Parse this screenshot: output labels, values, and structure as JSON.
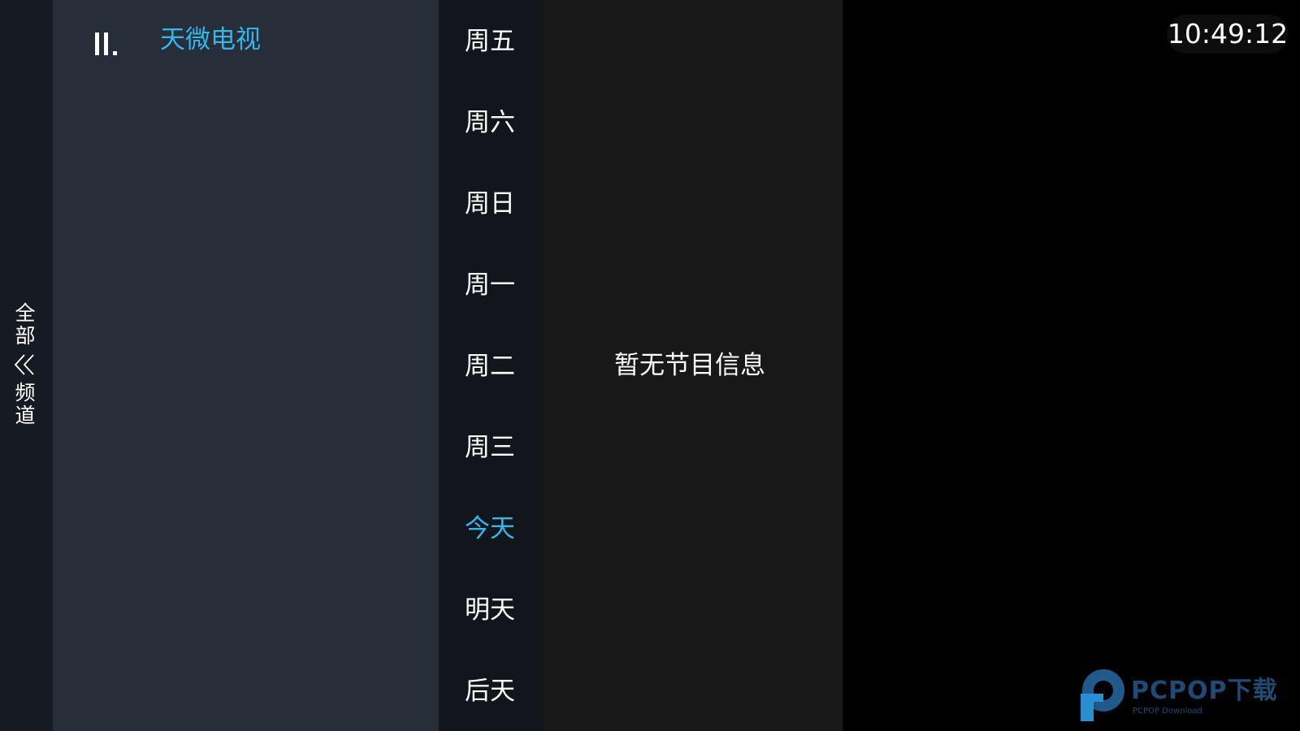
{
  "clock": "10:49:12",
  "category_strip": {
    "label_top": "全\n部",
    "label_bottom": "频\n道",
    "icon": "double-chevron-left-icon"
  },
  "channel": {
    "icon": "signal-bars-icon",
    "name": "天微电视"
  },
  "days": [
    {
      "label": "周五",
      "active": false
    },
    {
      "label": "周六",
      "active": false
    },
    {
      "label": "周日",
      "active": false
    },
    {
      "label": "周一",
      "active": false
    },
    {
      "label": "周二",
      "active": false
    },
    {
      "label": "周三",
      "active": false
    },
    {
      "label": "今天",
      "active": true
    },
    {
      "label": "明天",
      "active": false
    },
    {
      "label": "后天",
      "active": false
    }
  ],
  "program": {
    "empty_message": "暂无节目信息"
  },
  "watermark": {
    "icon": "pcpop-logo-icon",
    "title": "PCPOP下载",
    "subtitle": "PCPOP Download"
  },
  "colors": {
    "accent": "#2fb8ec",
    "text": "#ffffff",
    "strip_bg": "#161a22",
    "channel_bg": "#272d39",
    "day_bg": "#12161c",
    "program_bg": "#181818"
  }
}
